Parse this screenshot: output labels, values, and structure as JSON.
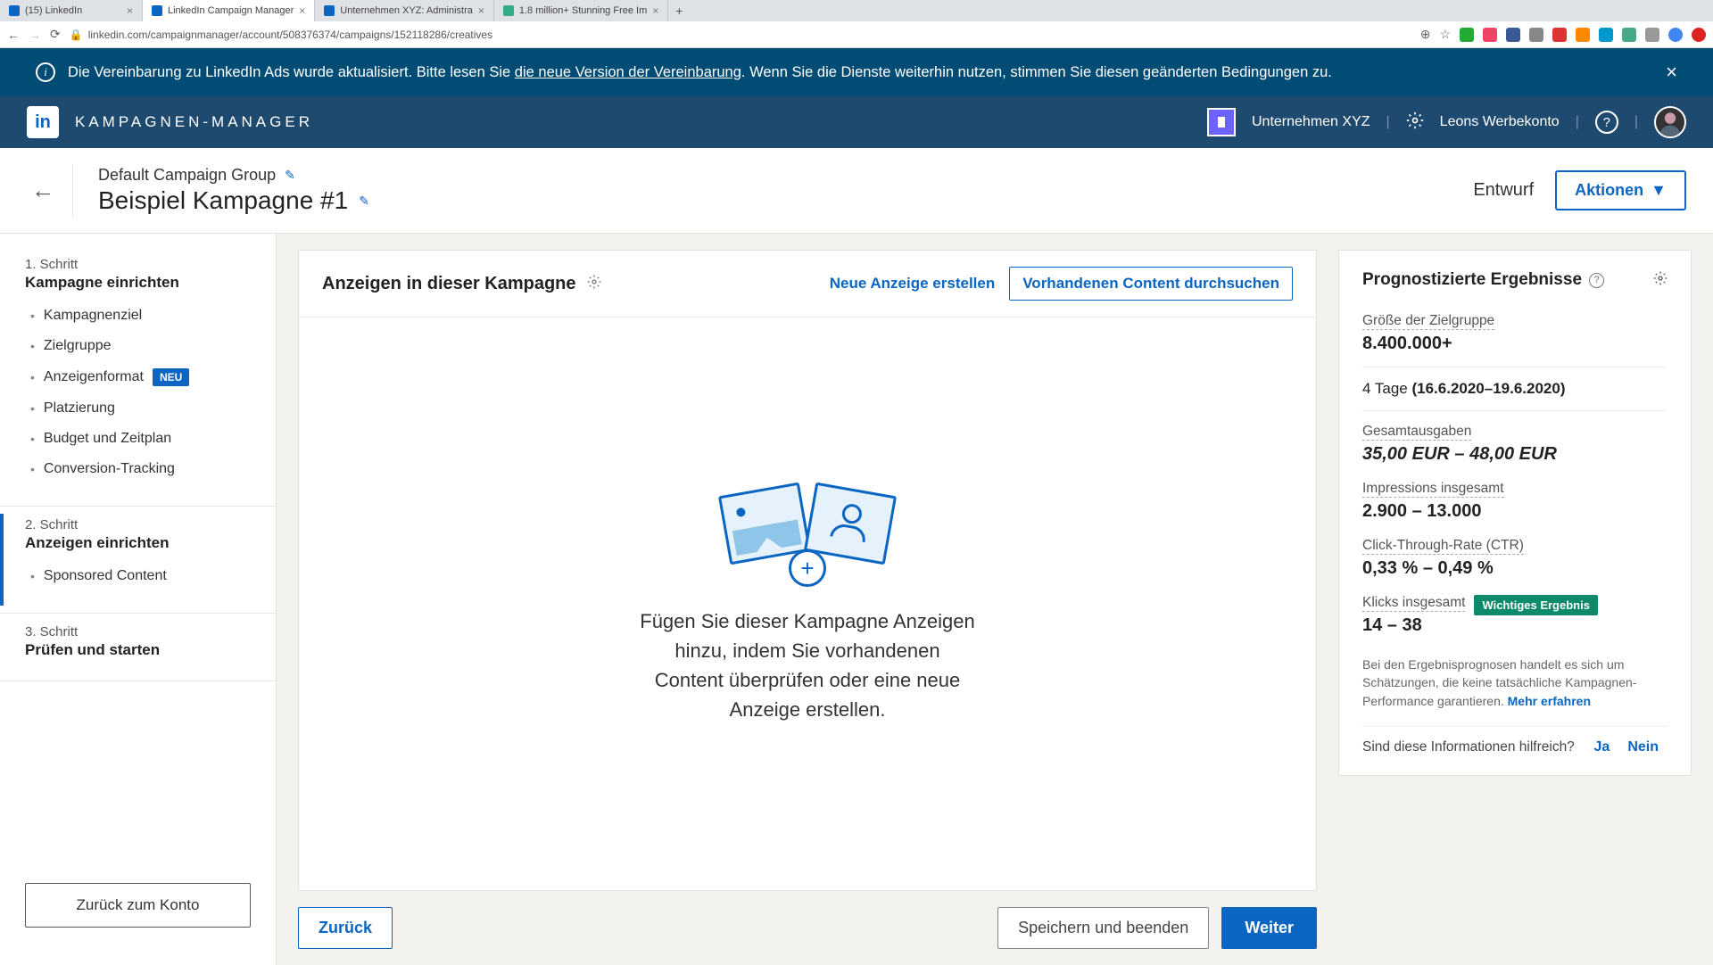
{
  "browser": {
    "tabs": [
      {
        "title": "(15) LinkedIn"
      },
      {
        "title": "LinkedIn Campaign Manager"
      },
      {
        "title": "Unternehmen XYZ: Administra"
      },
      {
        "title": "1.8 million+ Stunning Free Im"
      }
    ],
    "url": "linkedin.com/campaignmanager/account/508376374/campaigns/152118286/creatives"
  },
  "banner": {
    "text_pre": "Die Vereinbarung zu LinkedIn Ads wurde aktualisiert. Bitte lesen Sie ",
    "link": "die neue Version der Vereinbarung",
    "text_post": ". Wenn Sie die Dienste weiterhin nutzen, stimmen Sie diesen geänderten Bedingungen zu."
  },
  "header": {
    "app_title": "KAMPAGNEN-MANAGER",
    "company": "Unternehmen XYZ",
    "account": "Leons Werbekonto"
  },
  "sub_header": {
    "group": "Default Campaign Group",
    "campaign": "Beispiel Kampagne #1",
    "status": "Entwurf",
    "actions": "Aktionen"
  },
  "sidebar": {
    "step1": {
      "label": "1. Schritt",
      "title": "Kampagne einrichten",
      "items": [
        "Kampagnenziel",
        "Zielgruppe",
        "Anzeigenformat",
        "Platzierung",
        "Budget und Zeitplan",
        "Conversion-Tracking"
      ],
      "neu": "NEU"
    },
    "step2": {
      "label": "2. Schritt",
      "title": "Anzeigen einrichten",
      "items": [
        "Sponsored Content"
      ]
    },
    "step3": {
      "label": "3. Schritt",
      "title": "Prüfen und starten"
    },
    "back_btn": "Zurück zum Konto"
  },
  "panel": {
    "title": "Anzeigen in dieser Kampagne",
    "new_ad": "Neue Anzeige erstellen",
    "browse": "Vorhandenen Content durchsuchen",
    "empty": "Fügen Sie dieser Kampagne Anzeigen hinzu, indem Sie vorhandenen Content überprüfen oder eine neue Anzeige erstellen."
  },
  "footer": {
    "back": "Zurück",
    "save_exit": "Speichern und beenden",
    "next": "Weiter"
  },
  "forecast": {
    "title": "Prognostizierte Ergebnisse",
    "audience_label": "Größe der Zielgruppe",
    "audience_value": "8.400.000+",
    "days": "4 Tage ",
    "date_range": "(16.6.2020–19.6.2020)",
    "spend_label": "Gesamtausgaben",
    "spend_value": "35,00 EUR – 48,00 EUR",
    "impr_label": "Impressions insgesamt",
    "impr_value": "2.900 – 13.000",
    "ctr_label": "Click-Through-Rate (CTR)",
    "ctr_value": "0,33 % – 0,49 %",
    "clicks_label": "Klicks insgesamt",
    "clicks_value": "14 – 38",
    "important": "Wichtiges Ergebnis",
    "disclaimer": "Bei den Ergebnisprognosen handelt es sich um Schätzungen, die keine tatsächliche Kampagnen-Performance garantieren. ",
    "learn_more": "Mehr erfahren",
    "feedback_q": "Sind diese Informationen hilfreich?",
    "yes": "Ja",
    "no": "Nein"
  }
}
